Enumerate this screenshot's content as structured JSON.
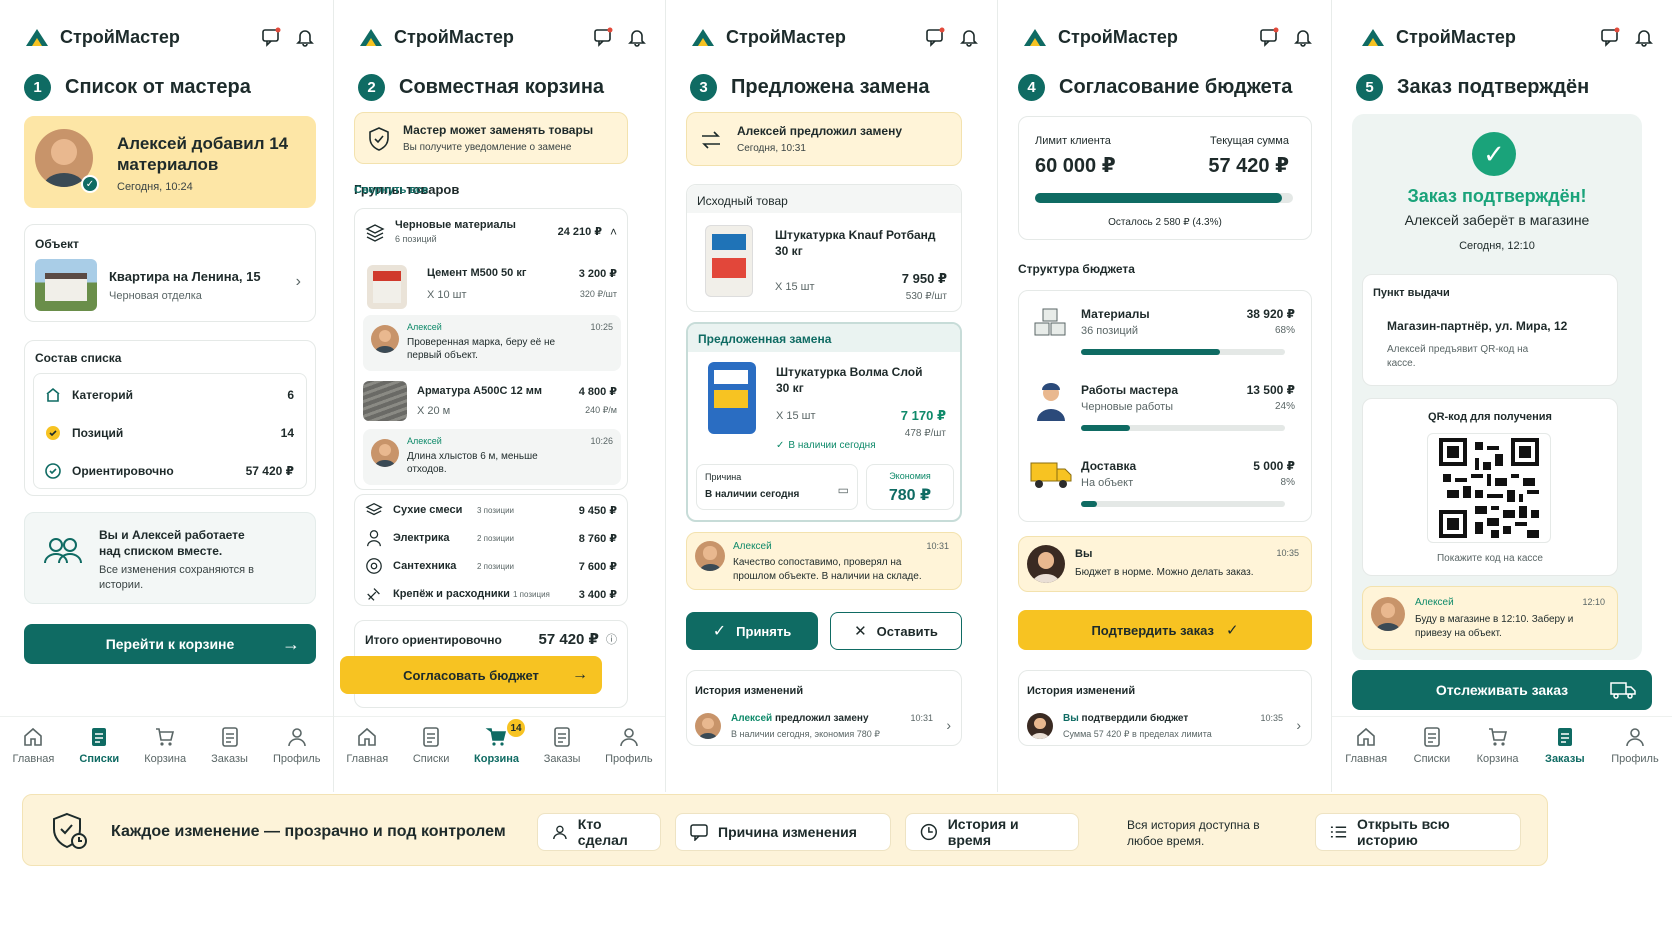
{
  "app": {
    "brand": "СтройМастер",
    "accent": "#0f6b63",
    "gold": "#f7c322"
  },
  "nav_labels": {
    "home": "Главная",
    "lists": "Списки",
    "cart": "Корзина",
    "orders": "Заказы",
    "profile": "Профиль",
    "cart_badge": "14"
  },
  "p1": {
    "step": "1",
    "title": "Список от мастера",
    "hero_title": "Алексей добавил 14 материалов",
    "hero_time": "Сегодня, 10:24",
    "object_label": "Объект",
    "object_name": "Квартира на Ленина, 15",
    "object_sub": "Черновая отделка",
    "composition_label": "Состав списка",
    "stats": [
      {
        "label": "Категорий",
        "value": "6"
      },
      {
        "label": "Позиций",
        "value": "14"
      },
      {
        "label": "Ориентировочно",
        "value": "57 420 ₽"
      }
    ],
    "together_title": "Вы и Алексей работаете над списком вместе.",
    "together_sub": "Все изменения сохраняются в истории.",
    "cta": "Перейти к корзине"
  },
  "p2": {
    "step": "2",
    "title": "Совместная корзина",
    "notice_title": "Мастер может заменять товары",
    "notice_sub": "Вы получите уведомление о замене",
    "groups_label": "Группы товаров",
    "collapse": "Свернуть все",
    "group1": {
      "name": "Черновые материалы",
      "count": "6 позиций",
      "sum": "24 210 ₽"
    },
    "item1": {
      "name": "Цемент М500 50 кг",
      "qty": "X 10 шт",
      "price": "3 200 ₽",
      "unit": "320 ₽/шт",
      "author": "Алексей",
      "time": "10:25",
      "comment": "Проверенная марка, беру её не первый объект."
    },
    "item2": {
      "name": "Арматура А500С 12 мм",
      "qty": "X 20 м",
      "price": "4 800 ₽",
      "unit": "240 ₽/м",
      "author": "Алексей",
      "time": "10:26",
      "comment": "Длина хлыстов 6 м, меньше отходов."
    },
    "groups": [
      {
        "name": "Сухие смеси",
        "count": "3 позиции",
        "sum": "9 450 ₽"
      },
      {
        "name": "Электрика",
        "count": "2 позиции",
        "sum": "8 760 ₽"
      },
      {
        "name": "Сантехника",
        "count": "2 позиции",
        "sum": "7 600 ₽"
      },
      {
        "name": "Крепёж и расходники",
        "count": "1 позиция",
        "sum": "3 400 ₽"
      }
    ],
    "total_label": "Итого ориентировочно",
    "total": "57 420 ₽",
    "cta": "Согласовать бюджет"
  },
  "p3": {
    "step": "3",
    "title": "Предложена замена",
    "notice_title": "Алексей предложил замену",
    "notice_time": "Сегодня, 10:31",
    "orig_label": "Исходный товар",
    "orig": {
      "name": "Штукатурка Knauf Ротбанд 30 кг",
      "qty": "X 15 шт",
      "price": "7 950 ₽",
      "unit": "530 ₽/шт"
    },
    "sub_label": "Предложенная замена",
    "sub": {
      "name": "Штукатурка Волма Слой 30 кг",
      "qty": "X 15 шт",
      "price": "7 170 ₽",
      "unit": "478 ₽/шт",
      "stock": "В наличии сегодня"
    },
    "reason_label": "Причина",
    "reason": "В наличии сегодня",
    "saving_label": "Экономия",
    "saving": "780 ₽",
    "comment": {
      "author": "Алексей",
      "time": "10:31",
      "text": "Качество сопоставимо, проверял на прошлом объекте. В наличии на складе."
    },
    "accept": "Принять",
    "keep": "Оставить",
    "history_label": "История изменений",
    "history": {
      "author": "Алексей",
      "action": "предложил замену",
      "time": "10:31",
      "sub": "В наличии сегодня, экономия 780 ₽"
    }
  },
  "p4": {
    "step": "4",
    "title": "Согласование бюджета",
    "limit_label": "Лимит клиента",
    "limit": "60 000 ₽",
    "current_label": "Текущая сумма",
    "current": "57 420 ₽",
    "budget_used": 0.957,
    "remaining": "Осталось 2 580 ₽ (4.3%)",
    "structure_label": "Структура бюджета",
    "items": [
      {
        "name": "Материалы",
        "sub": "36 позиций",
        "sum": "38 920 ₽",
        "pct": "68%",
        "share": 0.68
      },
      {
        "name": "Работы мастера",
        "sub": "Черновые работы",
        "sum": "13 500 ₽",
        "pct": "24%",
        "share": 0.24
      },
      {
        "name": "Доставка",
        "sub": "На объект",
        "sum": "5 000 ₽",
        "pct": "8%",
        "share": 0.08
      }
    ],
    "comment": {
      "author": "Вы",
      "time": "10:35",
      "text": "Бюджет в норме. Можно делать заказ."
    },
    "cta": "Подтвердить заказ",
    "history_label": "История изменений",
    "history": {
      "author": "Вы",
      "action": "подтвердили бюджет",
      "time": "10:35",
      "sub": "Сумма 57 420 ₽ в пределах лимита"
    }
  },
  "p5": {
    "step": "5",
    "title": "Заказ подтверждён",
    "confirm_title": "Заказ подтверждён!",
    "confirm_sub": "Алексей заберёт в магазине",
    "confirm_time": "Сегодня, 12:10",
    "pickup_label": "Пункт выдачи",
    "pickup_name": "Магазин-партнёр, ул. Мира, 12",
    "pickup_sub": "Алексей предъявит QR-код на кассе.",
    "qr_label": "QR-код для получения",
    "qr_hint": "Покажите код на кассе",
    "comment": {
      "author": "Алексей",
      "time": "12:10",
      "text": "Буду в магазине в 12:10. Заберу и привезу на объект."
    },
    "cta": "Отслеживать заказ"
  },
  "footer": {
    "title": "Каждое изменение — прозрачно и под контролем",
    "chips": [
      "Кто сделал",
      "Причина изменения",
      "История и время"
    ],
    "note": "Вся история доступна в любое время.",
    "open_history": "Открыть всю историю"
  }
}
